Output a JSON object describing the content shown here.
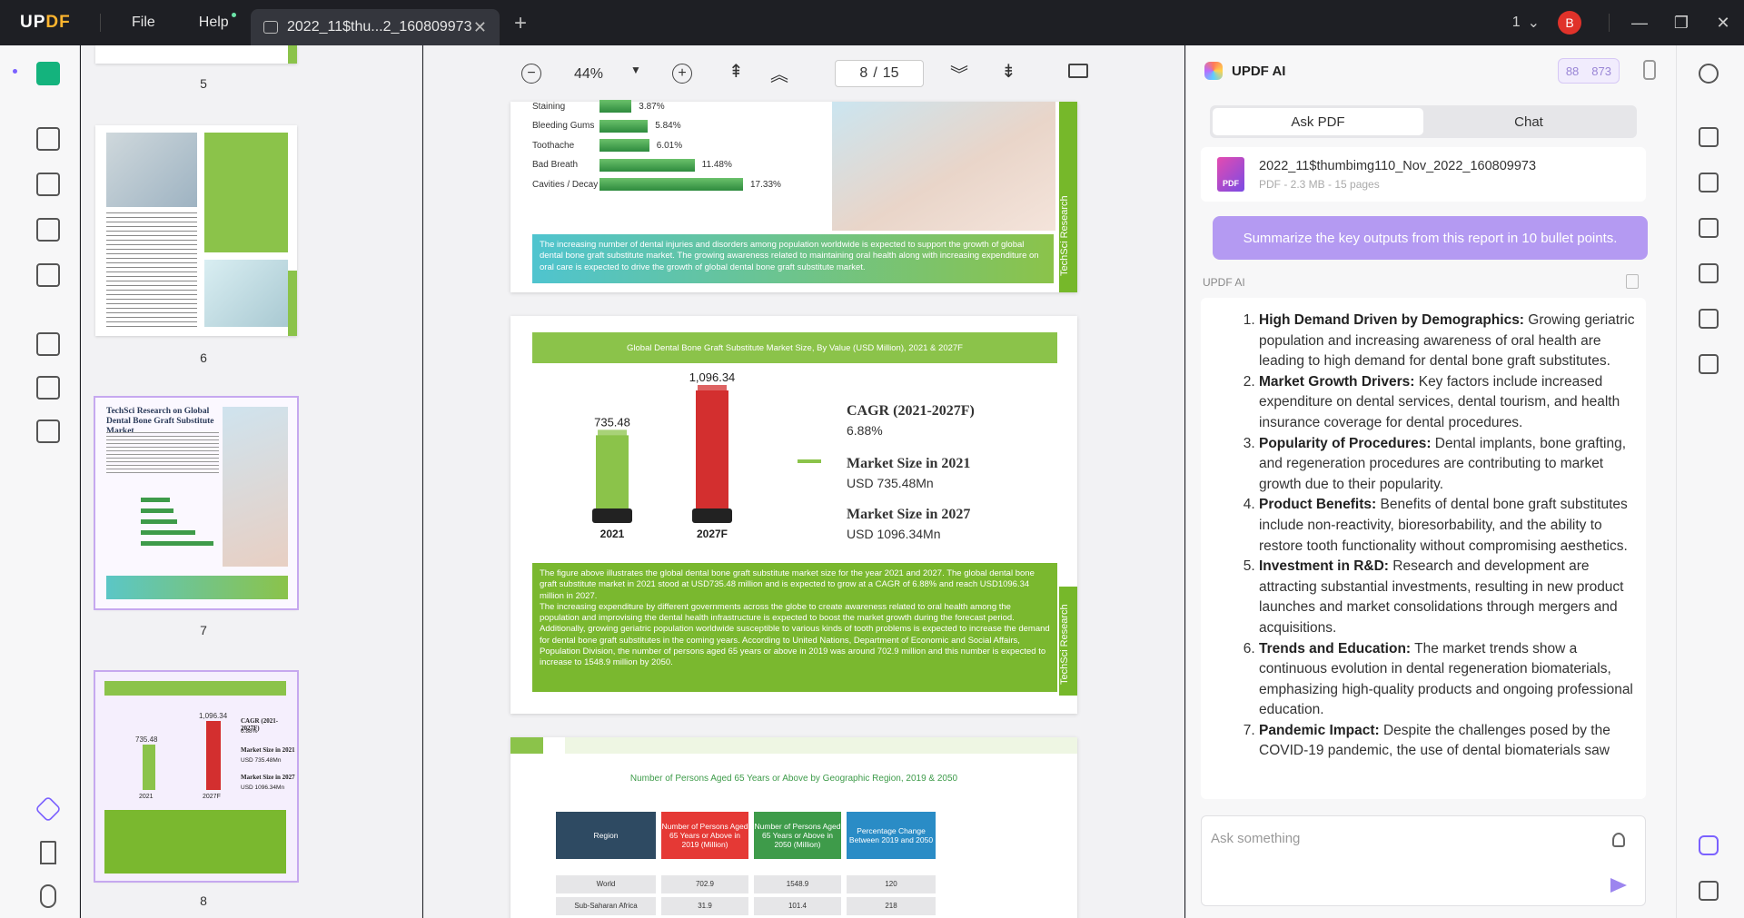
{
  "app": {
    "logo_main": "UPDF",
    "menu_file": "File",
    "menu_help": "Help",
    "tab_title": "2022_11$thu...2_160809973",
    "tab_close": "✕",
    "new_tab": "+",
    "window_count": "1",
    "avatar_letter": "B"
  },
  "toolbar": {
    "zoom": "44%",
    "current_page": "8",
    "page_sep": "/",
    "total_pages": "15"
  },
  "thumbnails": {
    "labels": [
      "5",
      "6",
      "7",
      "8"
    ],
    "p7_title": "TechSci Research on Global Dental Bone Graft Substitute Market",
    "p8_v2021": "735.48",
    "p8_v2027": "1,096.34",
    "p8_year1": "2021",
    "p8_year2": "2027F",
    "p8_cagr": "CAGR (2021-2027F)",
    "p8_cagr_val": "6.88%",
    "p8_ms21": "Market Size in 2021",
    "p8_ms21_val": "USD 735.48Mn",
    "p8_ms27": "Market Size in 2027",
    "p8_ms27_val": "USD 1096.34Mn"
  },
  "page7": {
    "bars": [
      {
        "label": "Staining",
        "value": "3.87%",
        "pct": 3.87
      },
      {
        "label": "Bleeding Gums",
        "value": "5.84%",
        "pct": 5.84
      },
      {
        "label": "Toothache",
        "value": "6.01%",
        "pct": 6.01
      },
      {
        "label": "Bad Breath",
        "value": "11.48%",
        "pct": 11.48
      },
      {
        "label": "Cavities / Decay",
        "value": "17.33%",
        "pct": 17.33
      }
    ],
    "caption": "The increasing number of dental injuries and disorders among population worldwide is expected to support the growth of global dental bone graft substitute market. The growing awareness related to maintaining oral health along with increasing expenditure on oral care is expected to drive the growth of global dental bone graft substitute market.",
    "brand": "TechSci Research"
  },
  "page8": {
    "header": "Global Dental Bone Graft Substitute Market Size, By Value (USD Million), 2021 & 2027F",
    "chart_data": {
      "type": "bar",
      "categories": [
        "2021",
        "2027F"
      ],
      "values": [
        735.48,
        1096.34
      ],
      "value_labels": [
        "735.48",
        "1,096.34"
      ],
      "colors": [
        "#8bc34a",
        "#d32f2f"
      ]
    },
    "cagr_label": "CAGR (2021-2027F)",
    "cagr_value": "6.88%",
    "ms21_label": "Market Size in 2021",
    "ms21_value": "USD 735.48Mn",
    "ms27_label": "Market Size in 2027",
    "ms27_value": "USD 1096.34Mn",
    "caption": "The figure above illustrates the global dental bone graft substitute market size for the year 2021 and 2027. The global dental bone graft substitute market in 2021 stood at USD735.48 million and is expected to grow at a CAGR of 6.88% and reach USD1096.34 million in 2027.\nThe increasing expenditure by different governments across the globe to create awareness related to oral health among the population and improvising the dental health infrastructure is expected to boost the market growth during the forecast period. Additionally, growing geriatric population worldwide susceptible to various kinds of tooth problems is expected to increase the demand for dental bone graft substitutes in the coming years. According to United Nations, Department of Economic and Social Affairs, Population Division, the number of persons aged 65 years or above in 2019 was around 702.9 million and this number is expected to increase to 1548.9 million by 2050.",
    "brand": "TechSci Research"
  },
  "page9": {
    "title": "Number of Persons Aged 65 Years or Above by Geographic Region, 2019 & 2050",
    "headers": [
      "Region",
      "Number of Persons Aged 65 Years or Above in 2019 (Million)",
      "Number of Persons Aged 65 Years or Above in 2050 (Million)",
      "Percentage Change Between 2019 and 2050"
    ],
    "rows": [
      [
        "World",
        "702.9",
        "1548.9",
        "120"
      ],
      [
        "Sub-Saharan Africa",
        "31.9",
        "101.4",
        "218"
      ]
    ]
  },
  "ai": {
    "title": "UPDF AI",
    "credit1": "88",
    "credit2": "873",
    "tab_ask": "Ask PDF",
    "tab_chat": "Chat",
    "file_name": "2022_11$thumbimg110_Nov_2022_160809973",
    "file_meta": "PDF - 2.3 MB - 15 pages",
    "pdf_badge": "PDF",
    "prompt": "Summarize the key outputs from this report in 10 bullet points.",
    "responder": "UPDF AI",
    "points": [
      {
        "head": "High Demand Driven by Demographics:",
        "body": " Growing geriatric population and increasing awareness of oral health are leading to high demand for dental bone graft substitutes."
      },
      {
        "head": "Market Growth Drivers:",
        "body": " Key factors include increased expenditure on dental services, dental tourism, and health insurance coverage for dental procedures."
      },
      {
        "head": "Popularity of Procedures:",
        "body": " Dental implants, bone grafting, and regeneration procedures are contributing to market growth due to their popularity."
      },
      {
        "head": "Product Benefits:",
        "body": " Benefits of dental bone graft substitutes include non-reactivity, bioresorbability, and the ability to restore tooth functionality without compromising aesthetics."
      },
      {
        "head": "Investment in R&D:",
        "body": " Research and development are attracting substantial investments, resulting in new product launches and market consolidations through mergers and acquisitions."
      },
      {
        "head": "Trends and Education:",
        "body": " The market trends show a continuous evolution in dental regeneration biomaterials, emphasizing high-quality products and ongoing professional education."
      },
      {
        "head": "Pandemic Impact:",
        "body": " Despite the challenges posed by the COVID-19 pandemic, the use of dental biomaterials saw"
      }
    ],
    "ask_placeholder": "Ask something"
  }
}
